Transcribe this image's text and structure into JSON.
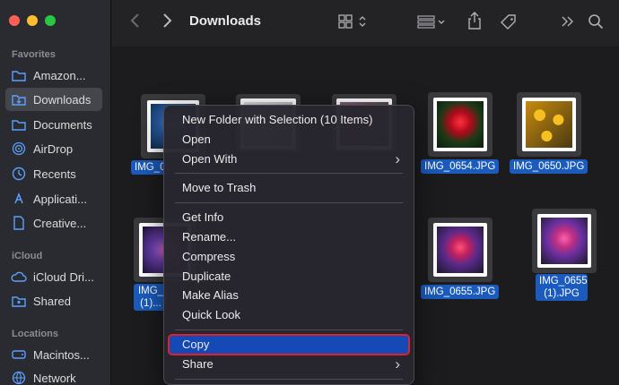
{
  "window": {
    "title": "Downloads"
  },
  "sidebar": {
    "favorites_title": "Favorites",
    "favorites": [
      {
        "label": "Amazon...",
        "icon": "folder-icon"
      },
      {
        "label": "Downloads",
        "icon": "download-folder-icon",
        "active": true
      },
      {
        "label": "Documents",
        "icon": "document-folder-icon"
      },
      {
        "label": "AirDrop",
        "icon": "airdrop-icon"
      },
      {
        "label": "Recents",
        "icon": "clock-icon"
      },
      {
        "label": "Applicati...",
        "icon": "applications-icon"
      },
      {
        "label": "Creative...",
        "icon": "document-icon"
      }
    ],
    "icloud_title": "iCloud",
    "icloud": [
      {
        "label": "iCloud Dri...",
        "icon": "cloud-icon"
      },
      {
        "label": "Shared",
        "icon": "shared-folder-icon"
      }
    ],
    "locations_title": "Locations",
    "locations": [
      {
        "label": "Macintos...",
        "icon": "disk-icon"
      },
      {
        "label": "Network",
        "icon": "globe-icon"
      }
    ]
  },
  "files": [
    {
      "label": "IMG_0",
      "colors": [
        "#2a5fa8",
        "#6fb0e8"
      ]
    },
    {
      "label": "",
      "colors": [
        "#c9c9c9",
        "#eeeeee"
      ]
    },
    {
      "label": "",
      "colors": [
        "#7a5a6a",
        "#cfa"
      ]
    },
    {
      "label": "IMG_0654.JPG",
      "colors": [
        "#1e3b1a",
        "#d0142a"
      ]
    },
    {
      "label": "IMG_0650.JPG",
      "colors": [
        "#d79a12",
        "#3a2a0a"
      ]
    },
    {
      "label": "IMG_\n(1)...",
      "colors": [
        "#5a3da0",
        "#e060c0"
      ]
    },
    {
      "label": "IMG_0655.JPG",
      "colors": [
        "#3a2a5a",
        "#e0305a"
      ]
    },
    {
      "label": "IMG_0655\n(1).JPG",
      "colors": [
        "#4a2a6a",
        "#e040a0"
      ]
    }
  ],
  "context_menu": {
    "items": [
      "New Folder with Selection (10 Items)",
      "Open",
      "Open With",
      "Move to Trash",
      "Get Info",
      "Rename...",
      "Compress",
      "Duplicate",
      "Make Alias",
      "Quick Look",
      "Copy",
      "Share"
    ]
  },
  "colors": {
    "selection": "#1a5bbd",
    "highlight": "#1549b5",
    "highlight_outline": "#e0202c"
  }
}
